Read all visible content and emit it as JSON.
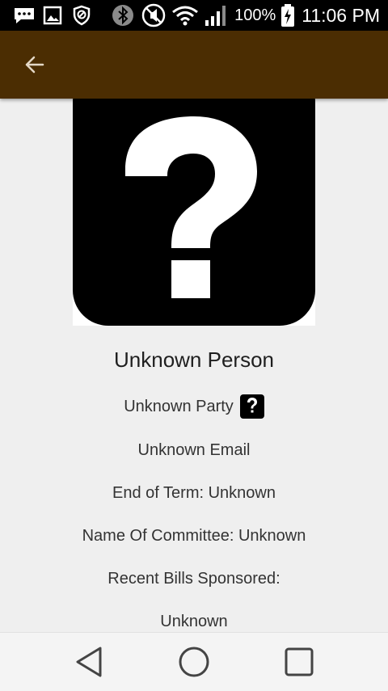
{
  "status_bar": {
    "battery_percent": "100%",
    "time": "11:06 PM",
    "icons": [
      "chat-icon",
      "image-icon",
      "shield-icon",
      "bluetooth-icon",
      "mute-icon",
      "wifi-icon",
      "signal-icon",
      "battery-charging-icon"
    ]
  },
  "app_bar": {
    "back_icon": "arrow-back-icon",
    "color": "#4b2d02"
  },
  "profile": {
    "name": "Unknown Person",
    "party": "Unknown Party",
    "party_icon": "question-icon",
    "email": "Unknown Email",
    "end_of_term": "End of Term: Unknown",
    "committee": "Name Of Committee: Unknown",
    "recent_bills_label": "Recent Bills Sponsored:",
    "recent_bills_value": "Unknown"
  },
  "nav_bar": {
    "icons": [
      "back-triangle-icon",
      "home-circle-icon",
      "recents-square-icon"
    ]
  }
}
